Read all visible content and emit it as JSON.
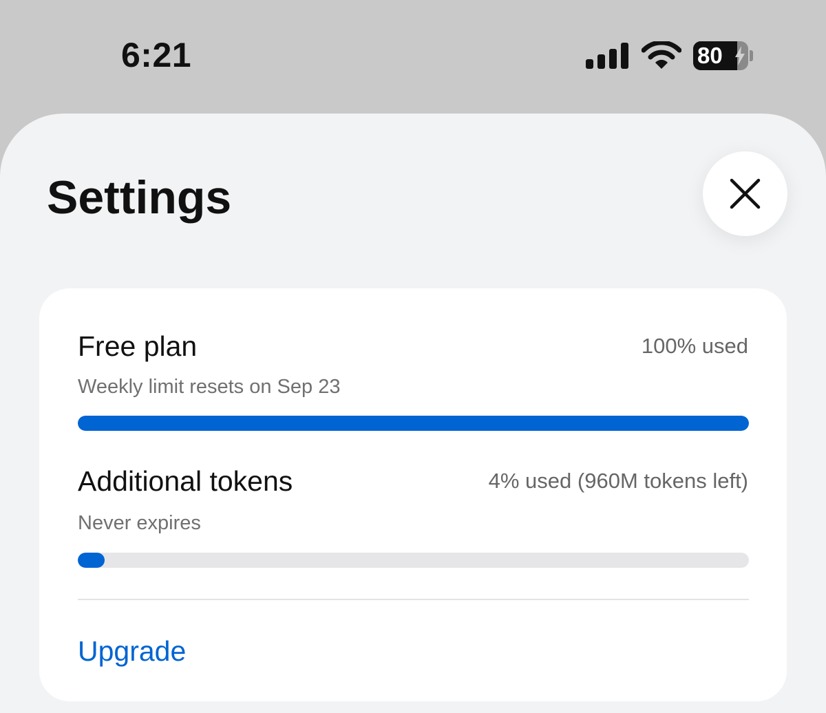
{
  "status_bar": {
    "time": "6:21",
    "battery_percent": "80",
    "battery_level": 0.8,
    "signal_icon": "cellular-signal-icon",
    "wifi_icon": "wifi-icon",
    "charging_icon": "lightning-bolt-icon"
  },
  "sheet": {
    "title": "Settings",
    "close_icon": "close-icon"
  },
  "usage": {
    "free_plan": {
      "title": "Free plan",
      "usage_text": "100% used",
      "subtitle": "Weekly limit resets on Sep 23",
      "progress": 1.0
    },
    "additional_tokens": {
      "title": "Additional tokens",
      "usage_text": "4% used (960M tokens left)",
      "subtitle": "Never expires",
      "progress": 0.04
    },
    "upgrade_label": "Upgrade"
  },
  "colors": {
    "accent": "#0064d2",
    "sheet_background": "#f2f3f5",
    "outer_background": "#c9c9c9",
    "card_background": "#ffffff",
    "track": "#e6e6e8"
  }
}
